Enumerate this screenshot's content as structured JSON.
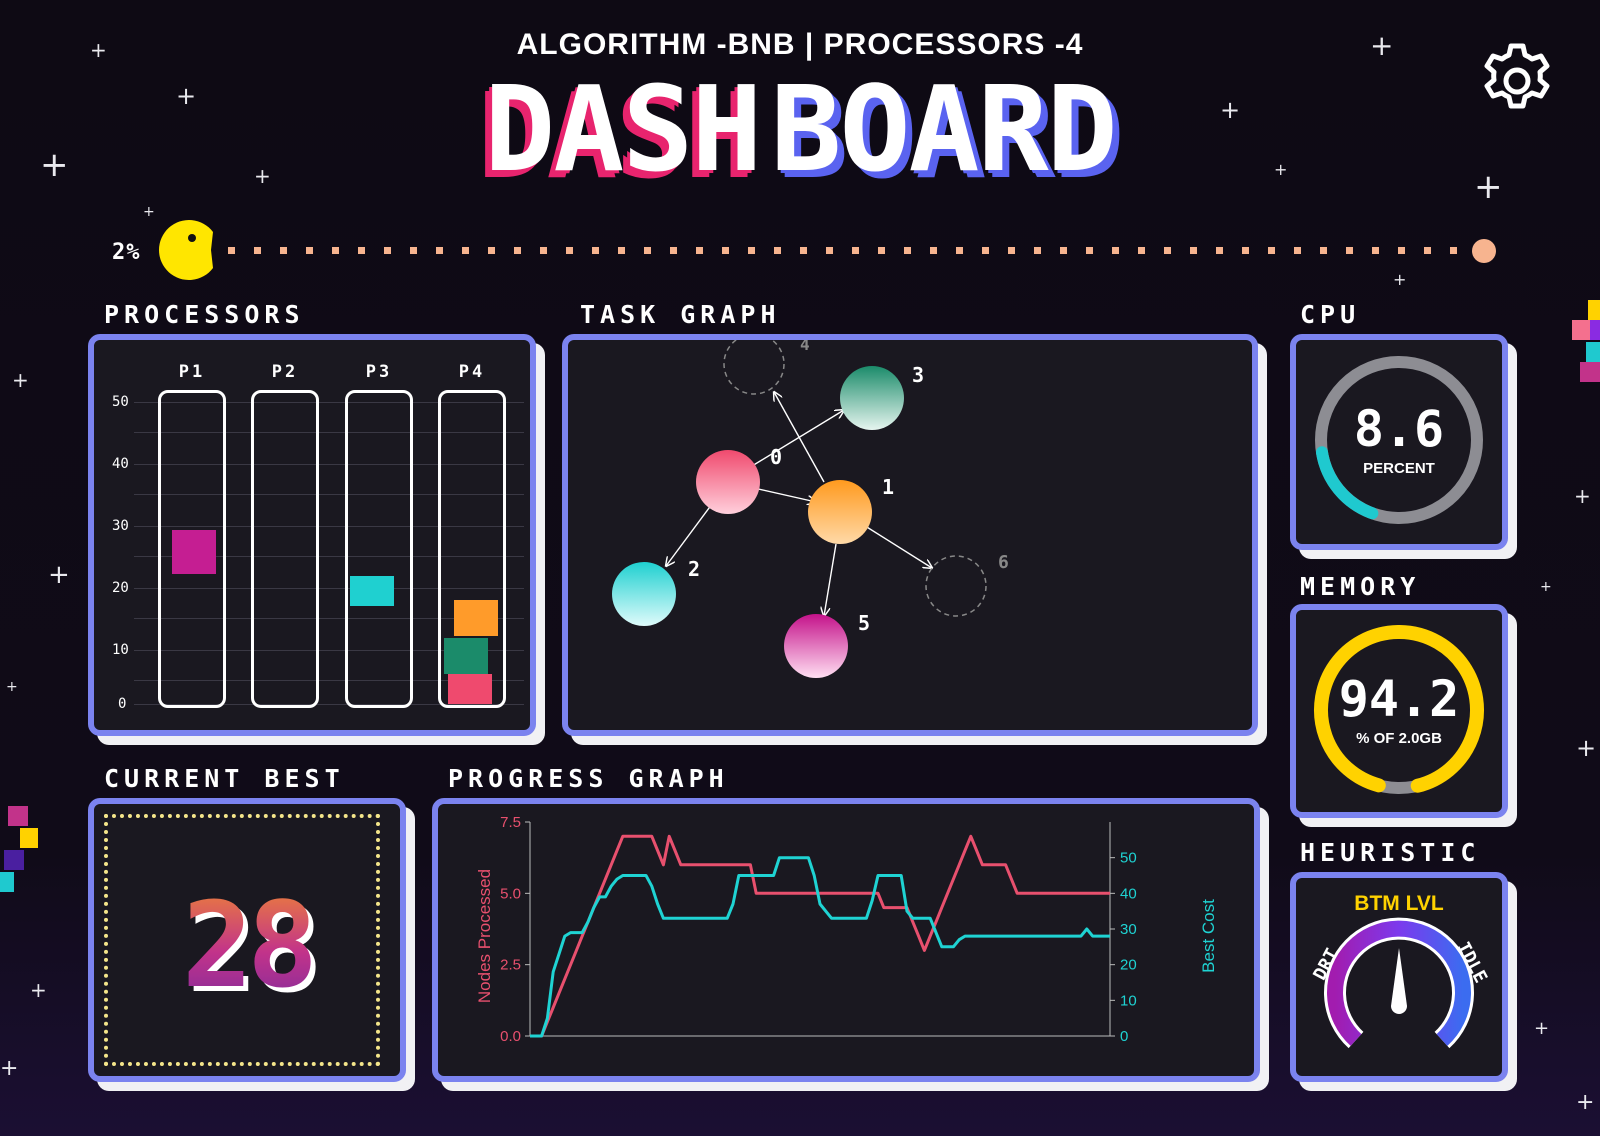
{
  "header": {
    "subtitle": "ALGORITHM -BNB | PROCESSORS -4",
    "title_part1": "DASH",
    "title_part2": "BOARD"
  },
  "progress": {
    "label": "2%",
    "value": 0.02,
    "dot_color": "#f7b48f",
    "pacman_color": "#ffe600"
  },
  "icons": {
    "settings": "gear-icon"
  },
  "processors": {
    "label": "PROCESSORS",
    "columns": [
      "P1",
      "P2",
      "P3",
      "P4"
    ],
    "y_ticks": [
      "50",
      "40",
      "30",
      "20",
      "10",
      "0"
    ]
  },
  "task_graph": {
    "label": "TASK GRAPH",
    "nodes": [
      {
        "id": "0",
        "label": "0"
      },
      {
        "id": "1",
        "label": "1"
      },
      {
        "id": "2",
        "label": "2"
      },
      {
        "id": "3",
        "label": "3"
      },
      {
        "id": "4",
        "label": "4"
      },
      {
        "id": "5",
        "label": "5"
      },
      {
        "id": "6",
        "label": "6"
      }
    ]
  },
  "cpu": {
    "label": "CPU",
    "value": "8.6",
    "unit": "PERCENT",
    "fraction": 0.086,
    "color": "#1fc9cf"
  },
  "memory": {
    "label": "MEMORY",
    "value": "94.2",
    "unit": "% OF 2.0GB",
    "fraction": 0.942,
    "color": "#ffd200"
  },
  "current_best": {
    "label": "CURRENT BEST",
    "value": "28"
  },
  "heuristic": {
    "label": "HEURISTIC",
    "level": "BTM LVL",
    "left": "DRT",
    "right": "IDLE"
  },
  "progress_graph": {
    "label": "PROGRESS GRAPH",
    "chart_data": {
      "type": "line",
      "xlabel": "",
      "ylabel": "Nodes Processed",
      "y2label": "Best Cost",
      "ylim": [
        0,
        7.5
      ],
      "y2lim": [
        0,
        60
      ],
      "yticks": [
        "0.0",
        "2.5",
        "5.0",
        "7.5"
      ],
      "y2ticks": [
        "0",
        "10",
        "20",
        "30",
        "40",
        "50"
      ],
      "x": [
        0,
        1,
        2,
        3,
        4,
        5,
        6,
        7,
        8,
        9,
        10,
        11,
        12,
        13,
        14,
        15,
        16,
        17,
        18,
        19,
        20,
        21,
        22,
        23,
        24,
        25,
        26,
        27,
        28,
        29,
        30,
        31,
        32,
        33,
        34,
        35,
        36,
        37,
        38,
        39,
        40,
        41,
        42,
        43,
        44,
        45,
        46,
        47,
        48,
        49,
        50,
        51,
        52,
        53,
        54,
        55,
        56,
        57,
        58,
        59,
        60,
        61,
        62,
        63,
        64,
        65,
        66,
        67,
        68,
        69,
        70,
        71,
        72,
        73,
        74,
        75,
        76,
        77,
        78,
        79,
        80,
        81,
        82,
        83,
        84,
        85,
        86,
        87,
        88,
        89,
        90,
        91,
        92,
        93,
        94,
        95,
        96,
        97,
        98,
        99,
        100
      ],
      "series": [
        {
          "name": "Nodes Processed",
          "color": "#e8506e",
          "axis": "left",
          "values": [
            0,
            0,
            0,
            0.5,
            1.0,
            1.5,
            2.0,
            2.5,
            3.0,
            3.5,
            4.0,
            4.5,
            5.0,
            5.5,
            6.0,
            6.5,
            7.0,
            7.0,
            7.0,
            7.0,
            7.0,
            7.0,
            6.5,
            6.0,
            7.0,
            6.5,
            6.0,
            6.0,
            6.0,
            6.0,
            6.0,
            6.0,
            6.0,
            6.0,
            6.0,
            6.0,
            6.0,
            6.0,
            6.0,
            5.0,
            5.0,
            5.0,
            5.0,
            5.0,
            5.0,
            5.0,
            5.0,
            5.0,
            5.0,
            5.0,
            5.0,
            5.0,
            5.0,
            5.0,
            5.0,
            5.0,
            5.0,
            5.0,
            5.0,
            5.0,
            5.0,
            4.5,
            4.5,
            4.5,
            4.5,
            4.5,
            4.0,
            3.5,
            3.0,
            3.5,
            4.0,
            4.5,
            5.0,
            5.5,
            6.0,
            6.5,
            7.0,
            6.5,
            6.0,
            6.0,
            6.0,
            6.0,
            6.0,
            5.5,
            5.0,
            5.0,
            5.0,
            5.0,
            5.0,
            5.0,
            5.0,
            5.0,
            5.0,
            5.0,
            5.0,
            5.0,
            5.0,
            5.0,
            5.0,
            5.0,
            5.0
          ]
        },
        {
          "name": "Best Cost",
          "color": "#1fd3d3",
          "axis": "right",
          "values": [
            0,
            0,
            0,
            5,
            18,
            23,
            28,
            29,
            29,
            29,
            32,
            36,
            39,
            39,
            42,
            44,
            45,
            45,
            45,
            45,
            45,
            42,
            37,
            33,
            33,
            33,
            33,
            33,
            33,
            33,
            33,
            33,
            33,
            33,
            33,
            37,
            45,
            45,
            45,
            45,
            45,
            45,
            45,
            50,
            50,
            50,
            50,
            50,
            50,
            45,
            37,
            35,
            33,
            33,
            33,
            33,
            33,
            33,
            33,
            38,
            45,
            45,
            45,
            45,
            45,
            35,
            33,
            33,
            33,
            33,
            29,
            25,
            25,
            25,
            27,
            28,
            28,
            28,
            28,
            28,
            28,
            28,
            28,
            28,
            28,
            28,
            28,
            28,
            28,
            28,
            28,
            28,
            28,
            28,
            28,
            28,
            30,
            28,
            28,
            28,
            28
          ]
        }
      ]
    }
  }
}
